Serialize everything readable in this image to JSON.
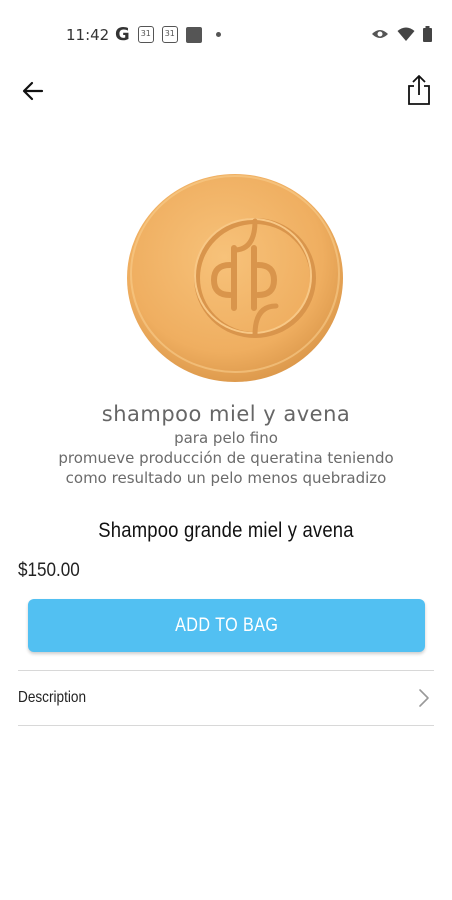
{
  "status_bar": {
    "time": "11:42",
    "icons_left": [
      "google-g-icon",
      "calendar-icon",
      "calendar-icon",
      "app-square-icon",
      "notification-dot-icon"
    ],
    "calendar_day": "31",
    "google_glyph": "G",
    "icons_right": [
      "eye-icon",
      "wifi-icon",
      "battery-icon"
    ]
  },
  "top_bar": {
    "back_icon": "arrow-left-icon",
    "share_icon": "share-icon"
  },
  "product": {
    "image_alt_icon": "soap-bar-image",
    "promo_title": "shampoo miel y avena",
    "promo_line1": "para pelo fino",
    "promo_line2": "promueve producción de queratina teniendo",
    "promo_line3": "como resultado un pelo menos quebradizo",
    "name": "Shampoo grande miel y avena",
    "price": "$150.00"
  },
  "actions": {
    "add_to_bag_label": "ADD TO BAG"
  },
  "description": {
    "label": "Description",
    "chevron_icon": "chevron-right-icon"
  },
  "colors": {
    "accent": "#52c0f2",
    "soap": "#f2b467",
    "divider": "#d8d8d8"
  }
}
